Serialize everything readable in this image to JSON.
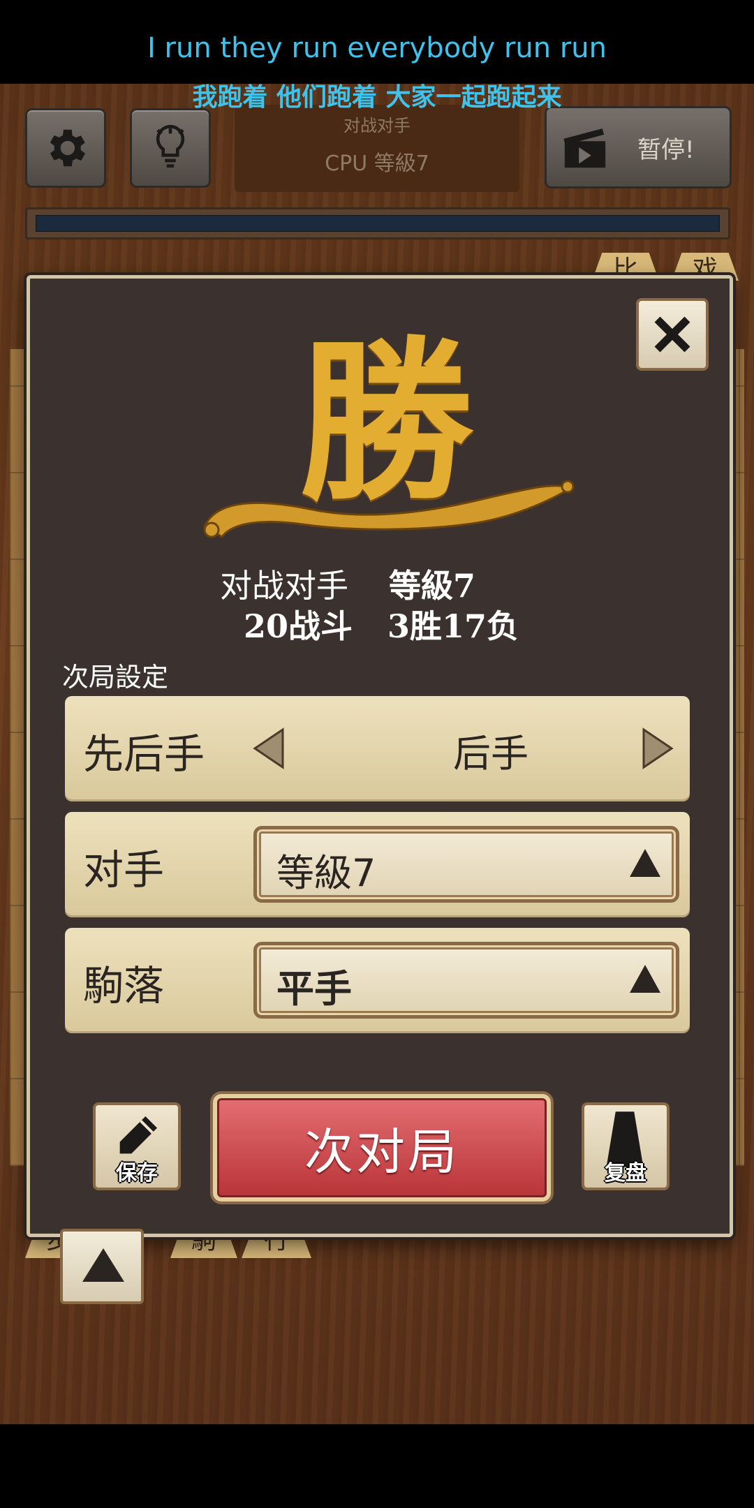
{
  "subtitles": {
    "line1": "I run they run everybody run run",
    "line2": "我跑着 他们跑着 大家一起跑起来"
  },
  "topbar": {
    "opponent_label": "对战对手",
    "opponent_value": "CPU 等級7",
    "pause_label": "暂停!"
  },
  "background_pieces": [
    "比",
    "戏",
    "步",
    "駒",
    "行"
  ],
  "dialog": {
    "result_char": "勝",
    "stats": {
      "opponent_label": "对战对手",
      "opponent_level": "等級7",
      "battles": "20战斗",
      "record": "3胜17负"
    },
    "next_settings_label": "次局設定",
    "turn": {
      "label": "先后手",
      "value": "后手"
    },
    "opponent": {
      "label": "对手",
      "value": "等級7"
    },
    "handicap": {
      "label": "駒落",
      "value": "平手"
    },
    "save_label": "保存",
    "next_game_label": "次对局",
    "review_label": "复盘"
  },
  "colors": {
    "subtitle": "#3fc3ec",
    "dialog_bg": "#3b3230",
    "panel_bg": "#ede1bd",
    "next_button": "#c94448",
    "win_gold": "#e3ad32"
  }
}
